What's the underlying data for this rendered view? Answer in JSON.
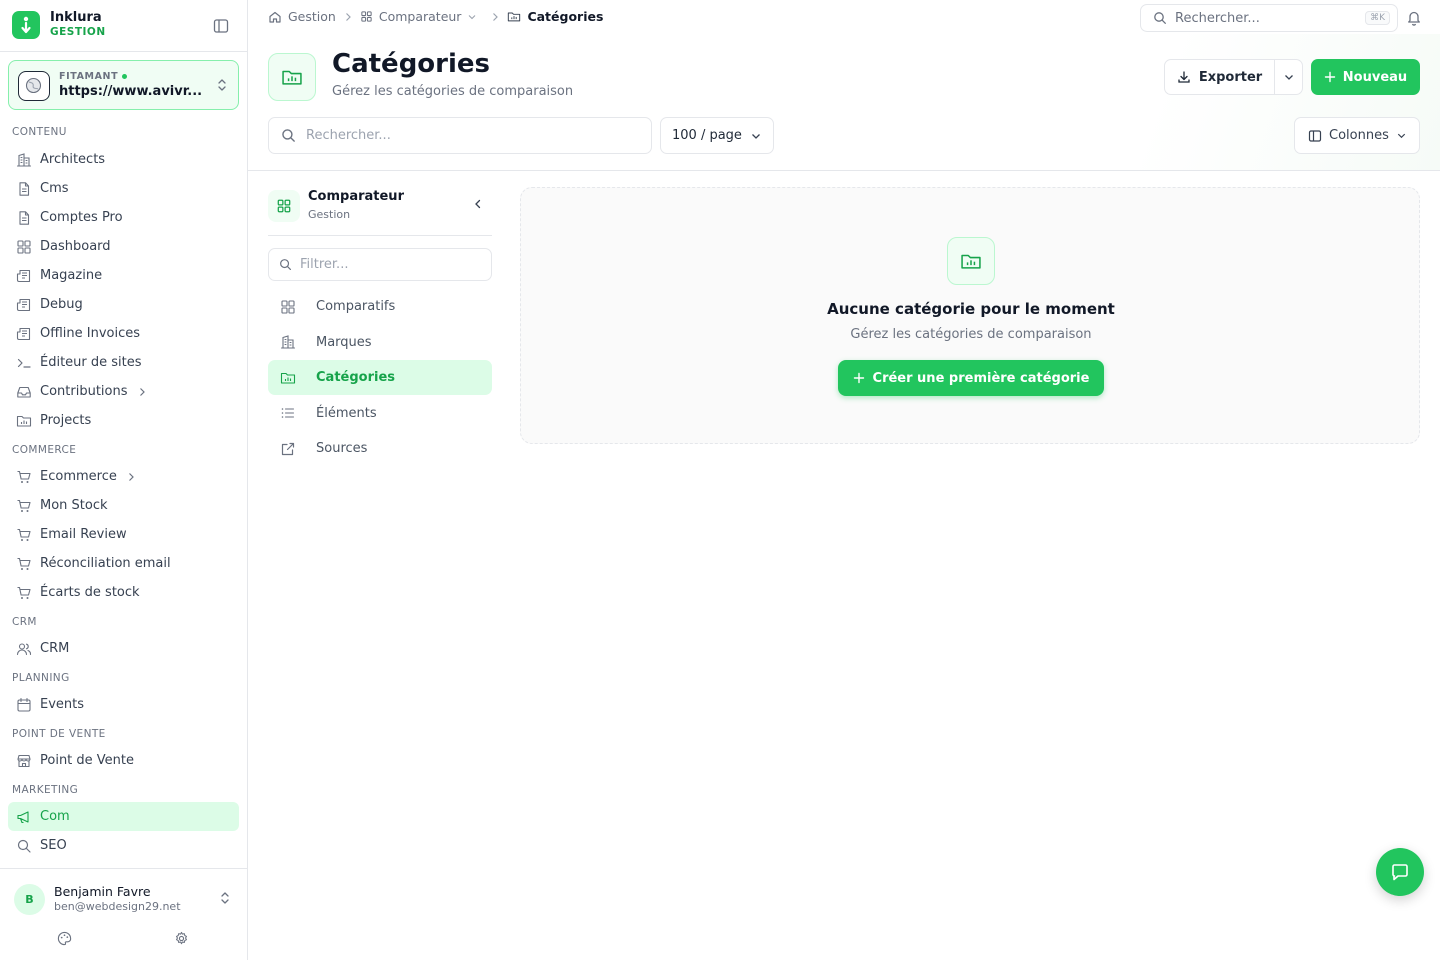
{
  "brand": {
    "name": "Inklura",
    "subtitle": "GESTION"
  },
  "site": {
    "label": "FITAMANT",
    "url": "https://www.avivr..."
  },
  "sidebar": {
    "sections": [
      {
        "title": "CONTENU",
        "items": [
          {
            "label": "Architects",
            "icon": "building-icon"
          },
          {
            "label": "Cms",
            "icon": "file-icon"
          },
          {
            "label": "Comptes Pro",
            "icon": "file-icon"
          },
          {
            "label": "Dashboard",
            "icon": "grid-icon"
          },
          {
            "label": "Magazine",
            "icon": "newspaper-icon"
          },
          {
            "label": "Debug",
            "icon": "newspaper-icon"
          },
          {
            "label": "Offline Invoices",
            "icon": "newspaper-icon"
          },
          {
            "label": "Éditeur de sites",
            "icon": "terminal-icon"
          },
          {
            "label": "Contributions",
            "icon": "inbox-icon",
            "has_children": true
          },
          {
            "label": "Projects",
            "icon": "folder-chart-icon"
          }
        ]
      },
      {
        "title": "COMMERCE",
        "items": [
          {
            "label": "Ecommerce",
            "icon": "cart-icon",
            "has_children": true
          },
          {
            "label": "Mon Stock",
            "icon": "cart-icon"
          },
          {
            "label": "Email Review",
            "icon": "cart-icon"
          },
          {
            "label": "Réconciliation email",
            "icon": "cart-icon"
          },
          {
            "label": "Écarts de stock",
            "icon": "cart-icon"
          }
        ]
      },
      {
        "title": "CRM",
        "items": [
          {
            "label": "CRM",
            "icon": "users-icon"
          }
        ]
      },
      {
        "title": "PLANNING",
        "items": [
          {
            "label": "Events",
            "icon": "calendar-icon"
          }
        ]
      },
      {
        "title": "POINT DE VENTE",
        "items": [
          {
            "label": "Point de Vente",
            "icon": "store-icon"
          }
        ]
      },
      {
        "title": "MARKETING",
        "items": [
          {
            "label": "Com",
            "icon": "megaphone-icon",
            "active": true
          },
          {
            "label": "SEO",
            "icon": "search-icon"
          }
        ]
      }
    ]
  },
  "user": {
    "initial": "B",
    "name": "Benjamin Favre",
    "email": "ben@webdesign29.net"
  },
  "breadcrumb": {
    "home": "Gestion",
    "parent": "Comparateur",
    "current": "Catégories"
  },
  "topbar": {
    "search_placeholder": "Rechercher...",
    "shortcut": "⌘K"
  },
  "page": {
    "title": "Catégories",
    "subtitle": "Gérez les catégories de comparaison",
    "export_label": "Exporter",
    "new_label": "Nouveau",
    "search_placeholder": "Rechercher...",
    "per_page": "100 / page",
    "columns_label": "Colonnes"
  },
  "panel": {
    "title": "Comparateur",
    "subtitle": "Gestion",
    "filter_placeholder": "Filtrer...",
    "items": [
      {
        "label": "Comparatifs",
        "icon": "grid-icon"
      },
      {
        "label": "Marques",
        "icon": "building-icon"
      },
      {
        "label": "Catégories",
        "icon": "folder-chart-icon",
        "active": true
      },
      {
        "label": "Éléments",
        "icon": "list-icon"
      },
      {
        "label": "Sources",
        "icon": "external-link-icon"
      }
    ]
  },
  "empty_state": {
    "title": "Aucune catégorie pour le moment",
    "subtitle": "Gérez les catégories de comparaison",
    "cta": "Créer une première catégorie"
  },
  "colors": {
    "accent": "#22c55e",
    "accent_dark": "#16a34a",
    "accent_light": "#dcfce7"
  }
}
